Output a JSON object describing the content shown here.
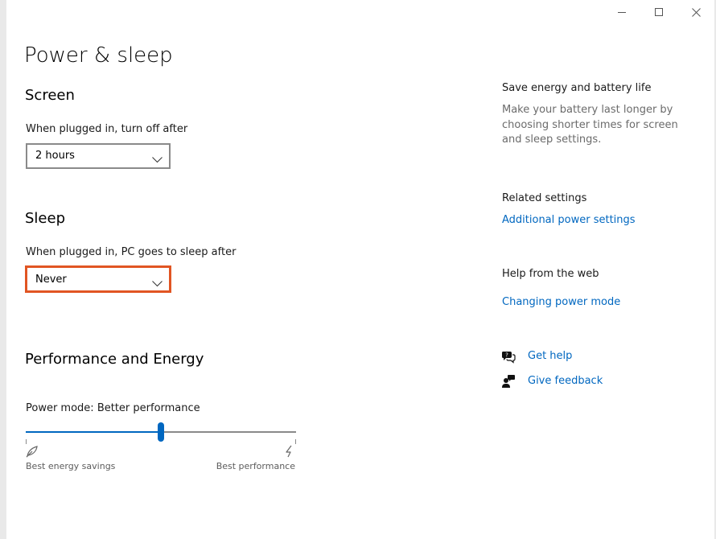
{
  "window": {
    "controls": {
      "minimize_icon": "minimize-icon",
      "maximize_icon": "maximize-icon",
      "close_icon": "close-icon"
    }
  },
  "page": {
    "title": "Power & sleep"
  },
  "screen": {
    "title": "Screen",
    "plugged_in_label": "When plugged in, turn off after",
    "plugged_in_value": "2 hours"
  },
  "sleep": {
    "title": "Sleep",
    "plugged_in_label": "When plugged in, PC goes to sleep after",
    "plugged_in_value": "Never",
    "focused": true
  },
  "performance": {
    "title": "Performance and Energy",
    "power_mode_label": "Power mode: Better performance",
    "slider_value_percent": 50,
    "min_label": "Best energy savings",
    "max_label": "Best performance",
    "min_icon": "leaf-icon",
    "max_icon": "lightning-icon"
  },
  "sidebar": {
    "save_energy": {
      "title": "Save energy and battery life",
      "text": "Make your battery last longer by choosing shorter times for screen and sleep settings."
    },
    "related": {
      "title": "Related settings",
      "link": "Additional power settings"
    },
    "help_web": {
      "title": "Help from the web",
      "link": "Changing power mode"
    },
    "get_help": {
      "label": "Get help",
      "icon": "get-help-icon"
    },
    "feedback": {
      "label": "Give feedback",
      "icon": "feedback-icon"
    }
  },
  "colors": {
    "accent": "#0067c0",
    "focus_border": "#e15523",
    "secondary_text": "#6b6b6b"
  }
}
